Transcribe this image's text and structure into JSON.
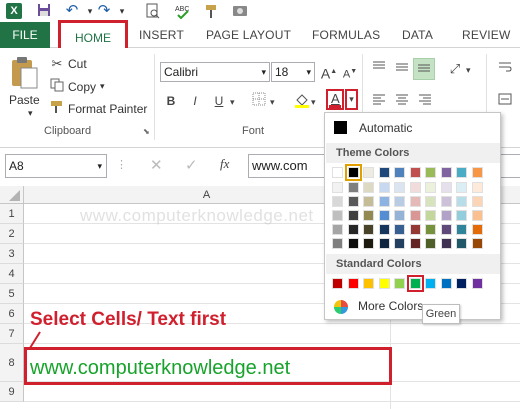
{
  "quick_access": {
    "icons": [
      "excel-icon",
      "save-icon",
      "undo-icon",
      "redo-icon",
      "print-preview-icon",
      "spelling-icon",
      "format-painter-icon",
      "camera-icon"
    ]
  },
  "ribbon_tabs": {
    "file": "FILE",
    "home": "HOME",
    "insert": "INSERT",
    "page_layout": "PAGE LAYOUT",
    "formulas": "FORMULAS",
    "data": "DATA",
    "review": "REVIEW"
  },
  "clipboard": {
    "paste": "Paste",
    "cut": "Cut",
    "copy": "Copy",
    "format_painter": "Format Painter",
    "group_label": "Clipboard"
  },
  "font": {
    "family": "Calibri",
    "size": "18",
    "bold": "B",
    "italic": "I",
    "underline": "U",
    "font_color_letter": "A",
    "grow": "A",
    "shrink": "A",
    "group_label": "Font"
  },
  "formula_bar": {
    "name_box": "A8",
    "fx": "fx",
    "content": "www.com"
  },
  "sheet": {
    "column_a": "A",
    "rows": [
      "1",
      "2",
      "3",
      "4",
      "5",
      "6",
      "7",
      "8",
      "9"
    ],
    "cell_a8": "www.computerknowledge.net"
  },
  "annotation": {
    "instruction": "Select Cells/ Text first",
    "watermark": "www.computerknowledge.net"
  },
  "color_menu": {
    "automatic": "Automatic",
    "theme_colors": "Theme Colors",
    "standard_colors": "Standard Colors",
    "more_colors": "More Colors...",
    "tooltip": "Green",
    "theme_top": [
      "#ffffff",
      "#000000",
      "#eeece1",
      "#1f497d",
      "#4f81bd",
      "#c0504d",
      "#9bbb59",
      "#8064a2",
      "#4bacc6",
      "#f79646"
    ],
    "theme_shades": [
      [
        "#f2f2f2",
        "#7f7f7f",
        "#ddd9c3",
        "#c6d9f0",
        "#dbe5f1",
        "#f2dcdb",
        "#ebf1dd",
        "#e5e0ec",
        "#dbeef3",
        "#fdeada"
      ],
      [
        "#d8d8d8",
        "#595959",
        "#c4bd97",
        "#8db3e2",
        "#b8cce4",
        "#e5b9b7",
        "#d7e3bc",
        "#ccc1d9",
        "#b7dde8",
        "#fbd5b5"
      ],
      [
        "#bfbfbf",
        "#3f3f3f",
        "#938953",
        "#548dd4",
        "#95b3d7",
        "#d99694",
        "#c3d69b",
        "#b2a2c7",
        "#92cddc",
        "#fac08f"
      ],
      [
        "#a5a5a5",
        "#262626",
        "#494429",
        "#17365d",
        "#366092",
        "#953734",
        "#76923c",
        "#5f497a",
        "#31859b",
        "#e36c09"
      ],
      [
        "#7f7f7f",
        "#0c0c0c",
        "#1d1b10",
        "#0f243e",
        "#244061",
        "#632423",
        "#4f6128",
        "#3f3151",
        "#205867",
        "#974806"
      ]
    ],
    "standard": [
      "#c00000",
      "#ff0000",
      "#ffc000",
      "#ffff00",
      "#92d050",
      "#00b050",
      "#00b0f0",
      "#0070c0",
      "#002060",
      "#7030a0"
    ]
  },
  "colors": {
    "excel_green": "#217346",
    "highlight_red": "#d0202e",
    "url_green": "#17a32b"
  }
}
